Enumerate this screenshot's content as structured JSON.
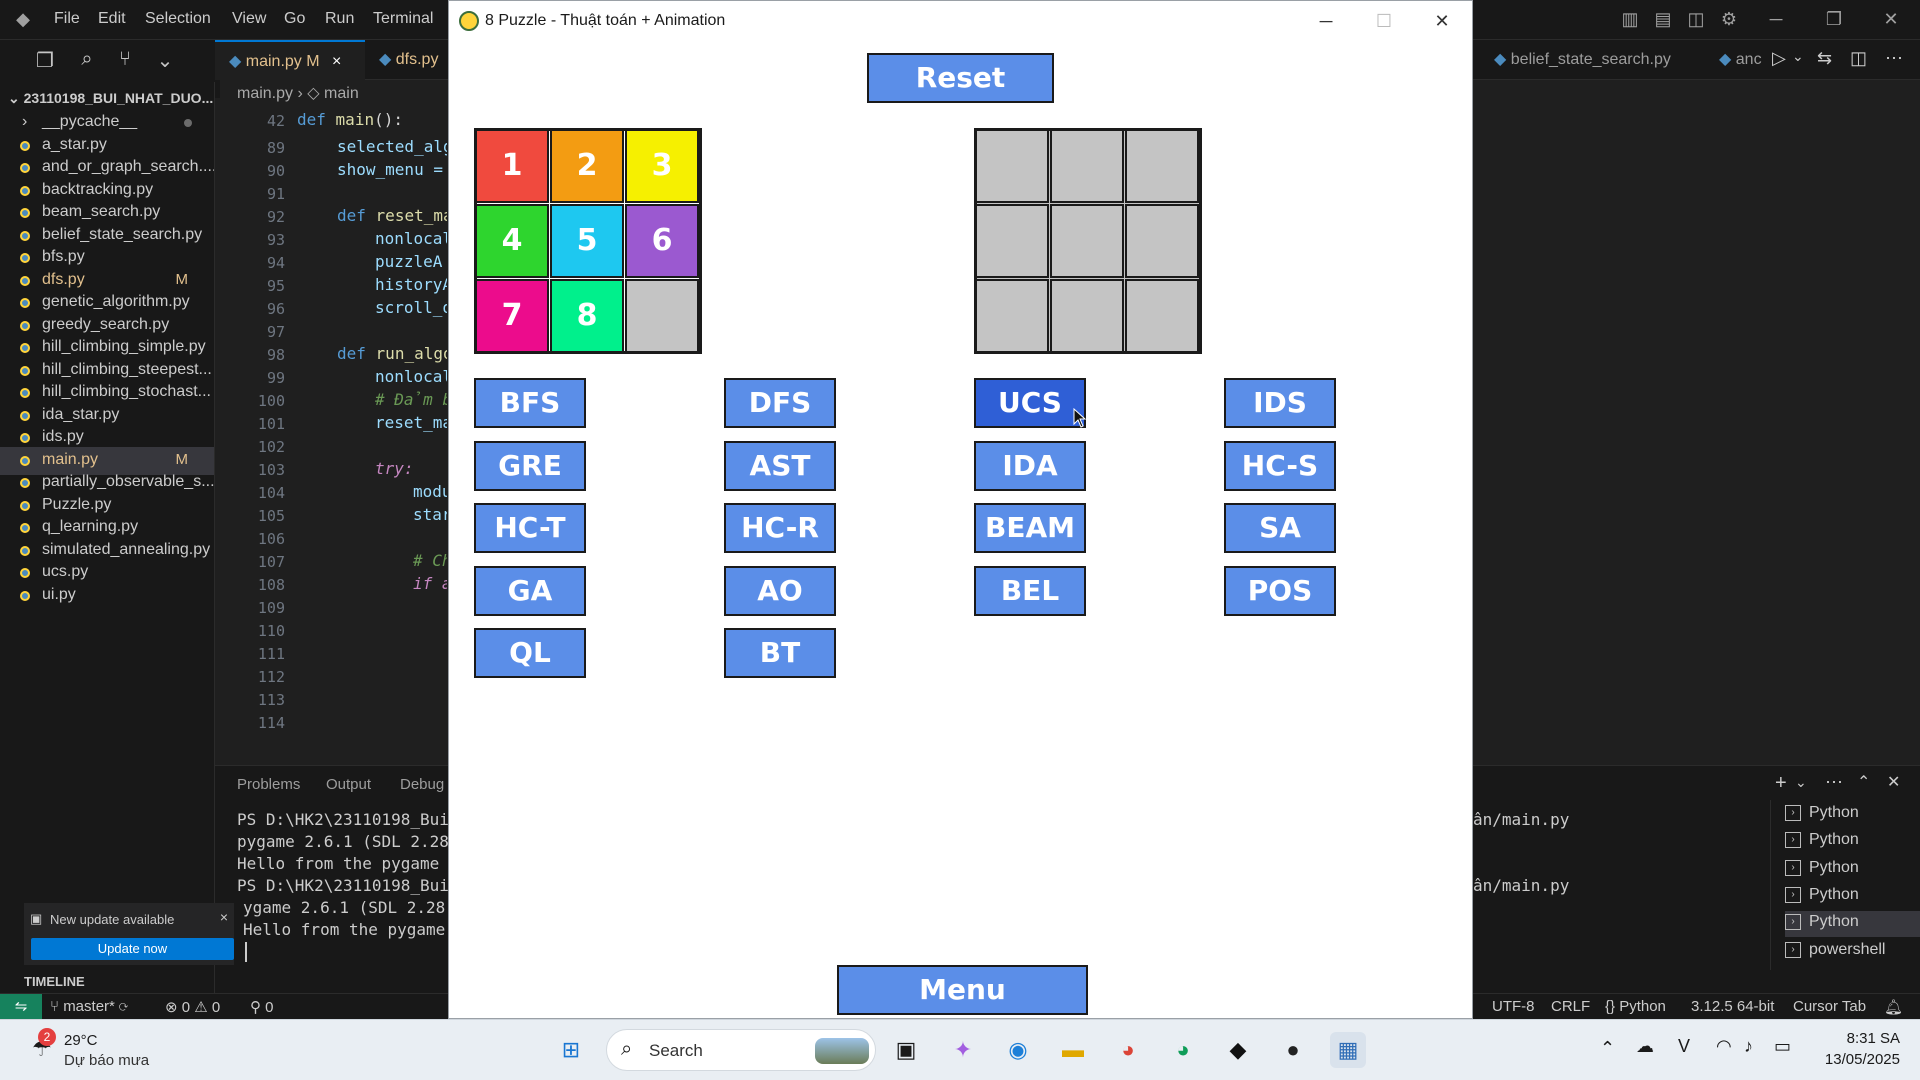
{
  "vscode": {
    "menu": [
      "File",
      "Edit",
      "Selection",
      "View",
      "Go",
      "Run",
      "Terminal"
    ],
    "tabs": [
      {
        "label": "main.py",
        "badge": "M",
        "close": "×"
      },
      {
        "label": "dfs.py"
      },
      {
        "label": "belief_state_search.py"
      },
      {
        "label": "anc"
      }
    ],
    "breadcrumb": {
      "file": "main.py",
      "sep": "›",
      "symbol": "main"
    },
    "explorer": {
      "root": "23110198_BUI_NHAT_DUO...",
      "files": [
        {
          "name": "__pycache__",
          "badge": ""
        },
        {
          "name": "a_star.py",
          "badge": ""
        },
        {
          "name": "and_or_graph_search....",
          "badge": ""
        },
        {
          "name": "backtracking.py",
          "badge": ""
        },
        {
          "name": "beam_search.py",
          "badge": ""
        },
        {
          "name": "belief_state_search.py",
          "badge": ""
        },
        {
          "name": "bfs.py",
          "badge": ""
        },
        {
          "name": "dfs.py",
          "badge": "M"
        },
        {
          "name": "genetic_algorithm.py",
          "badge": ""
        },
        {
          "name": "greedy_search.py",
          "badge": ""
        },
        {
          "name": "hill_climbing_simple.py",
          "badge": ""
        },
        {
          "name": "hill_climbing_steepest...",
          "badge": ""
        },
        {
          "name": "hill_climbing_stochast...",
          "badge": ""
        },
        {
          "name": "ida_star.py",
          "badge": ""
        },
        {
          "name": "ids.py",
          "badge": ""
        },
        {
          "name": "main.py",
          "badge": "M"
        },
        {
          "name": "partially_observable_s...",
          "badge": ""
        },
        {
          "name": "Puzzle.py",
          "badge": ""
        },
        {
          "name": "q_learning.py",
          "badge": ""
        },
        {
          "name": "simulated_annealing.py",
          "badge": ""
        },
        {
          "name": "ucs.py",
          "badge": ""
        },
        {
          "name": "ui.py",
          "badge": ""
        }
      ]
    },
    "line_numbers": [
      "42",
      "89",
      "90",
      "91",
      "92",
      "93",
      "94",
      "95",
      "96",
      "97",
      "98",
      "99",
      "100",
      "101",
      "102",
      "103",
      "104",
      "105",
      "106",
      "107",
      "108",
      "109",
      "110",
      "111",
      "112",
      "113",
      "114"
    ],
    "code": {
      "l42_kw": "def",
      "l42_fn": "main",
      "l42_rest": "():",
      "l89": "selected_alg",
      "l90": "show_menu =",
      "l92_kw": "def",
      "l92_fn": "reset_ma",
      "l93": "nonlocal",
      "l94": "puzzleA",
      "l95": "historyA",
      "l96": "scroll_o",
      "l98_kw": "def",
      "l98_fn": "run_algo",
      "l99": "nonlocal",
      "l100": "# Đảm bả",
      "l101": "reset_ma",
      "l103": "try:",
      "l104": "modu",
      "l105": "star",
      "l107": "# Ch",
      "l108": "if a"
    },
    "panel_tabs": [
      "Problems",
      "Output",
      "Debug"
    ],
    "terminal_lines": [
      "PS D:\\HK2\\23110198_Bui_",
      "pygame 2.6.1 (SDL 2.28.",
      "Hello from the pygame c",
      "PS D:\\HK2\\23110198_Bui_",
      "ygame 2.6.1 (SDL 2.28.",
      "Hello from the pygame c"
    ],
    "terminal_right": [
      "ân/main.py",
      "ân/main.py"
    ],
    "terminal_list": [
      "Python",
      "Python",
      "Python",
      "Python",
      "Python",
      "powershell"
    ],
    "notification": {
      "title": "New update available",
      "button": "Update now",
      "close": "×"
    },
    "timeline": "TIMELINE",
    "status": {
      "branch": "master*",
      "errors": "0",
      "warnings": "0",
      "ports": "0",
      "encoding": "UTF-8",
      "eol": "CRLF",
      "language": "Python",
      "version": "3.12.5 64-bit",
      "cursor": "Cursor Tab"
    }
  },
  "pygame": {
    "title": "8 Puzzle - Thuật toán + Animation",
    "reset_label": "Reset",
    "menu_label": "Menu",
    "tiles": [
      "1",
      "2",
      "3",
      "4",
      "5",
      "6",
      "7",
      "8",
      ""
    ],
    "tile_colors": [
      "#f04a3e",
      "#f39c12",
      "#f6f000",
      "#2ed52e",
      "#1ec8f0",
      "#9b59d0",
      "#ec0c8c",
      "#00f08c",
      "#c4c4c4"
    ],
    "algorithms": [
      "BFS",
      "DFS",
      "UCS",
      "IDS",
      "GRE",
      "AST",
      "IDA",
      "HC-S",
      "HC-T",
      "HC-R",
      "BEAM",
      "SA",
      "GA",
      "AO",
      "BEL",
      "POS",
      "QL",
      "BT"
    ],
    "highlighted": "UCS"
  },
  "taskbar": {
    "weather_temp": "29°C",
    "weather_desc": "Dự báo mưa",
    "weather_badge": "2",
    "search_label": "Search",
    "time": "8:31 SA",
    "date": "13/05/2025"
  }
}
